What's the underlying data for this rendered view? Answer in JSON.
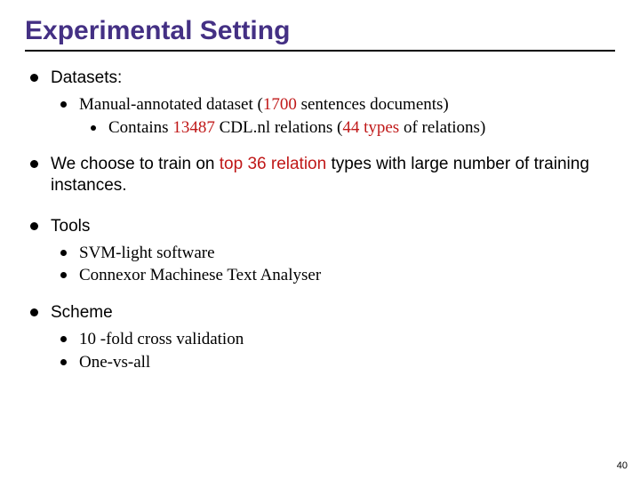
{
  "title": "Experimental Setting",
  "page_number": "40",
  "sections": {
    "datasets": {
      "heading": "Datasets:",
      "manual_pre": "Manual-annotated dataset (",
      "manual_num": "1700",
      "manual_post": " sentences documents)",
      "contains_pre": "Contains ",
      "contains_num1": "13487",
      "contains_mid": " CDL.nl relations (",
      "contains_num2": "44 types",
      "contains_post": " of relations)"
    },
    "choose": {
      "pre": "We choose to train on ",
      "em": "top 36 relation",
      "post": " types with large number of training instances."
    },
    "tools": {
      "heading": "Tools",
      "i1": "SVM-light software",
      "i2": "Connexor Machinese Text Analyser"
    },
    "scheme": {
      "heading": "Scheme",
      "i1": "10 -fold cross validation",
      "i2": "One-vs-all"
    }
  }
}
